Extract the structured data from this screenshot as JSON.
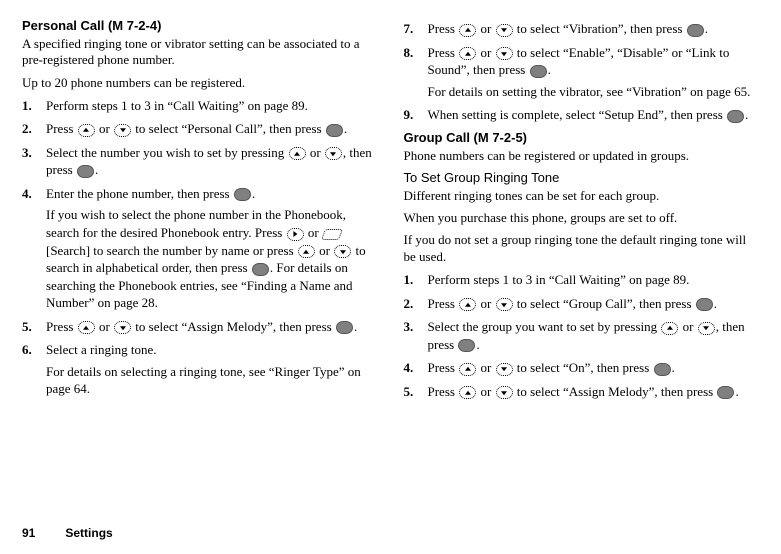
{
  "left": {
    "heading": "Personal Call (M 7-2-4)",
    "intro1": "A specified ringing tone or vibrator setting can be associated to a pre-registered phone number.",
    "intro2": "Up to 20 phone numbers can be registered.",
    "steps": {
      "s1": "Perform steps 1 to 3 in “Call Waiting” on page 89.",
      "s2a": "Press ",
      "s2b": " or ",
      "s2c": " to select “Personal Call”, then press ",
      "s2d": ".",
      "s3a": "Select the number you wish to set by pressing ",
      "s3b": " or ",
      "s3c": ", then press ",
      "s3d": ".",
      "s4a": "Enter the phone number, then press ",
      "s4b": ".",
      "s4sub1a": "If you wish to select the phone number in the Phonebook, search for the desired Phonebook entry. Press ",
      "s4sub1b": " or ",
      "s4sub1c": " [Search] to search the number by name or press ",
      "s4sub1d": " or ",
      "s4sub1e": " to search in alphabetical order, then press ",
      "s4sub1f": ". For details on searching the Phonebook entries, see “Finding a Name and Number” on page 28.",
      "s5a": "Press ",
      "s5b": " or ",
      "s5c": " to select “Assign Melody”, then press ",
      "s5d": ".",
      "s6": "Select a ringing tone.",
      "s6sub": "For details on selecting a ringing tone, see “Ringer Type” on page 64."
    }
  },
  "right": {
    "steps": {
      "s7a": "Press ",
      "s7b": " or ",
      "s7c": " to select “Vibration”, then press ",
      "s7d": ".",
      "s8a": "Press ",
      "s8b": " or ",
      "s8c": " to select “Enable”, “Disable” or “Link to Sound”, then press ",
      "s8d": ".",
      "s8sub": "For details on setting the vibrator, see “Vibration” on page 65.",
      "s9a": "When setting is complete, select “Setup End”, then press ",
      "s9b": "."
    },
    "heading2": "Group Call (M 7-2-5)",
    "intro2a": "Phone numbers can be registered or updated in groups.",
    "subheading": "To Set Group Ringing Tone",
    "intro2b": "Different ringing tones can be set for each group.",
    "intro2c": "When you purchase this phone, groups are set to off.",
    "intro2d": "If you do not set a group ringing tone the default ringing tone will be used.",
    "gsteps": {
      "s1": "Perform steps 1 to 3 in “Call Waiting” on page 89.",
      "s2a": "Press ",
      "s2b": " or ",
      "s2c": " to select “Group Call”, then press ",
      "s2d": ".",
      "s3a": "Select the group you want to set by pressing ",
      "s3b": " or ",
      "s3c": ", then press ",
      "s3d": ".",
      "s4a": "Press ",
      "s4b": " or ",
      "s4c": " to select “On”, then press ",
      "s4d": ".",
      "s5a": "Press ",
      "s5b": " or ",
      "s5c": " to select “Assign Melody”, then press ",
      "s5d": "."
    }
  },
  "footer": {
    "page": "91",
    "section": "Settings"
  }
}
